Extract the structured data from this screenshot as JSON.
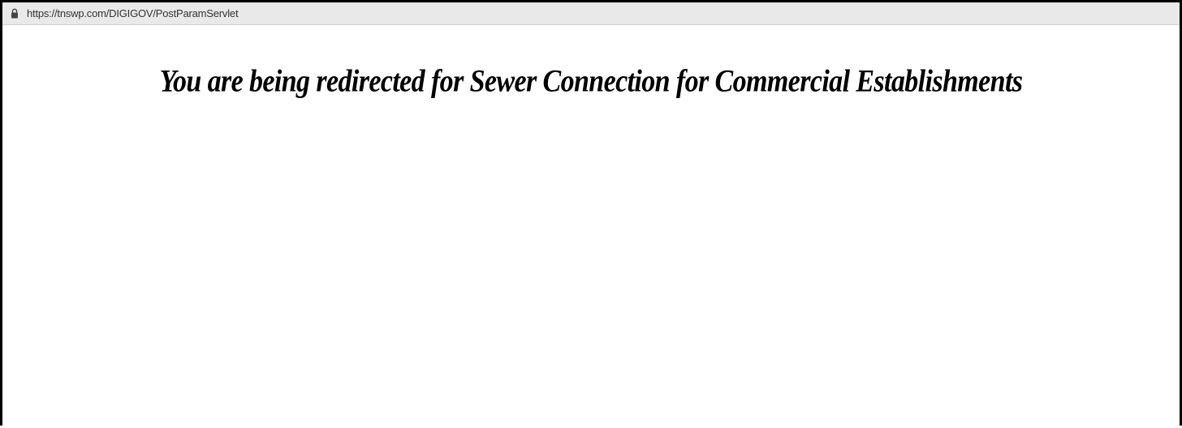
{
  "address_bar": {
    "url": "https://tnswp.com/DIGIGOV/PostParamServlet",
    "icon": "lock-icon"
  },
  "page": {
    "heading": "You are being redirected for Sewer Connection for Commercial Establishments"
  },
  "colors": {
    "address_bar_bg": "#e9e9e9",
    "page_bg": "#ffffff",
    "text": "#000000",
    "frame": "#000000"
  }
}
